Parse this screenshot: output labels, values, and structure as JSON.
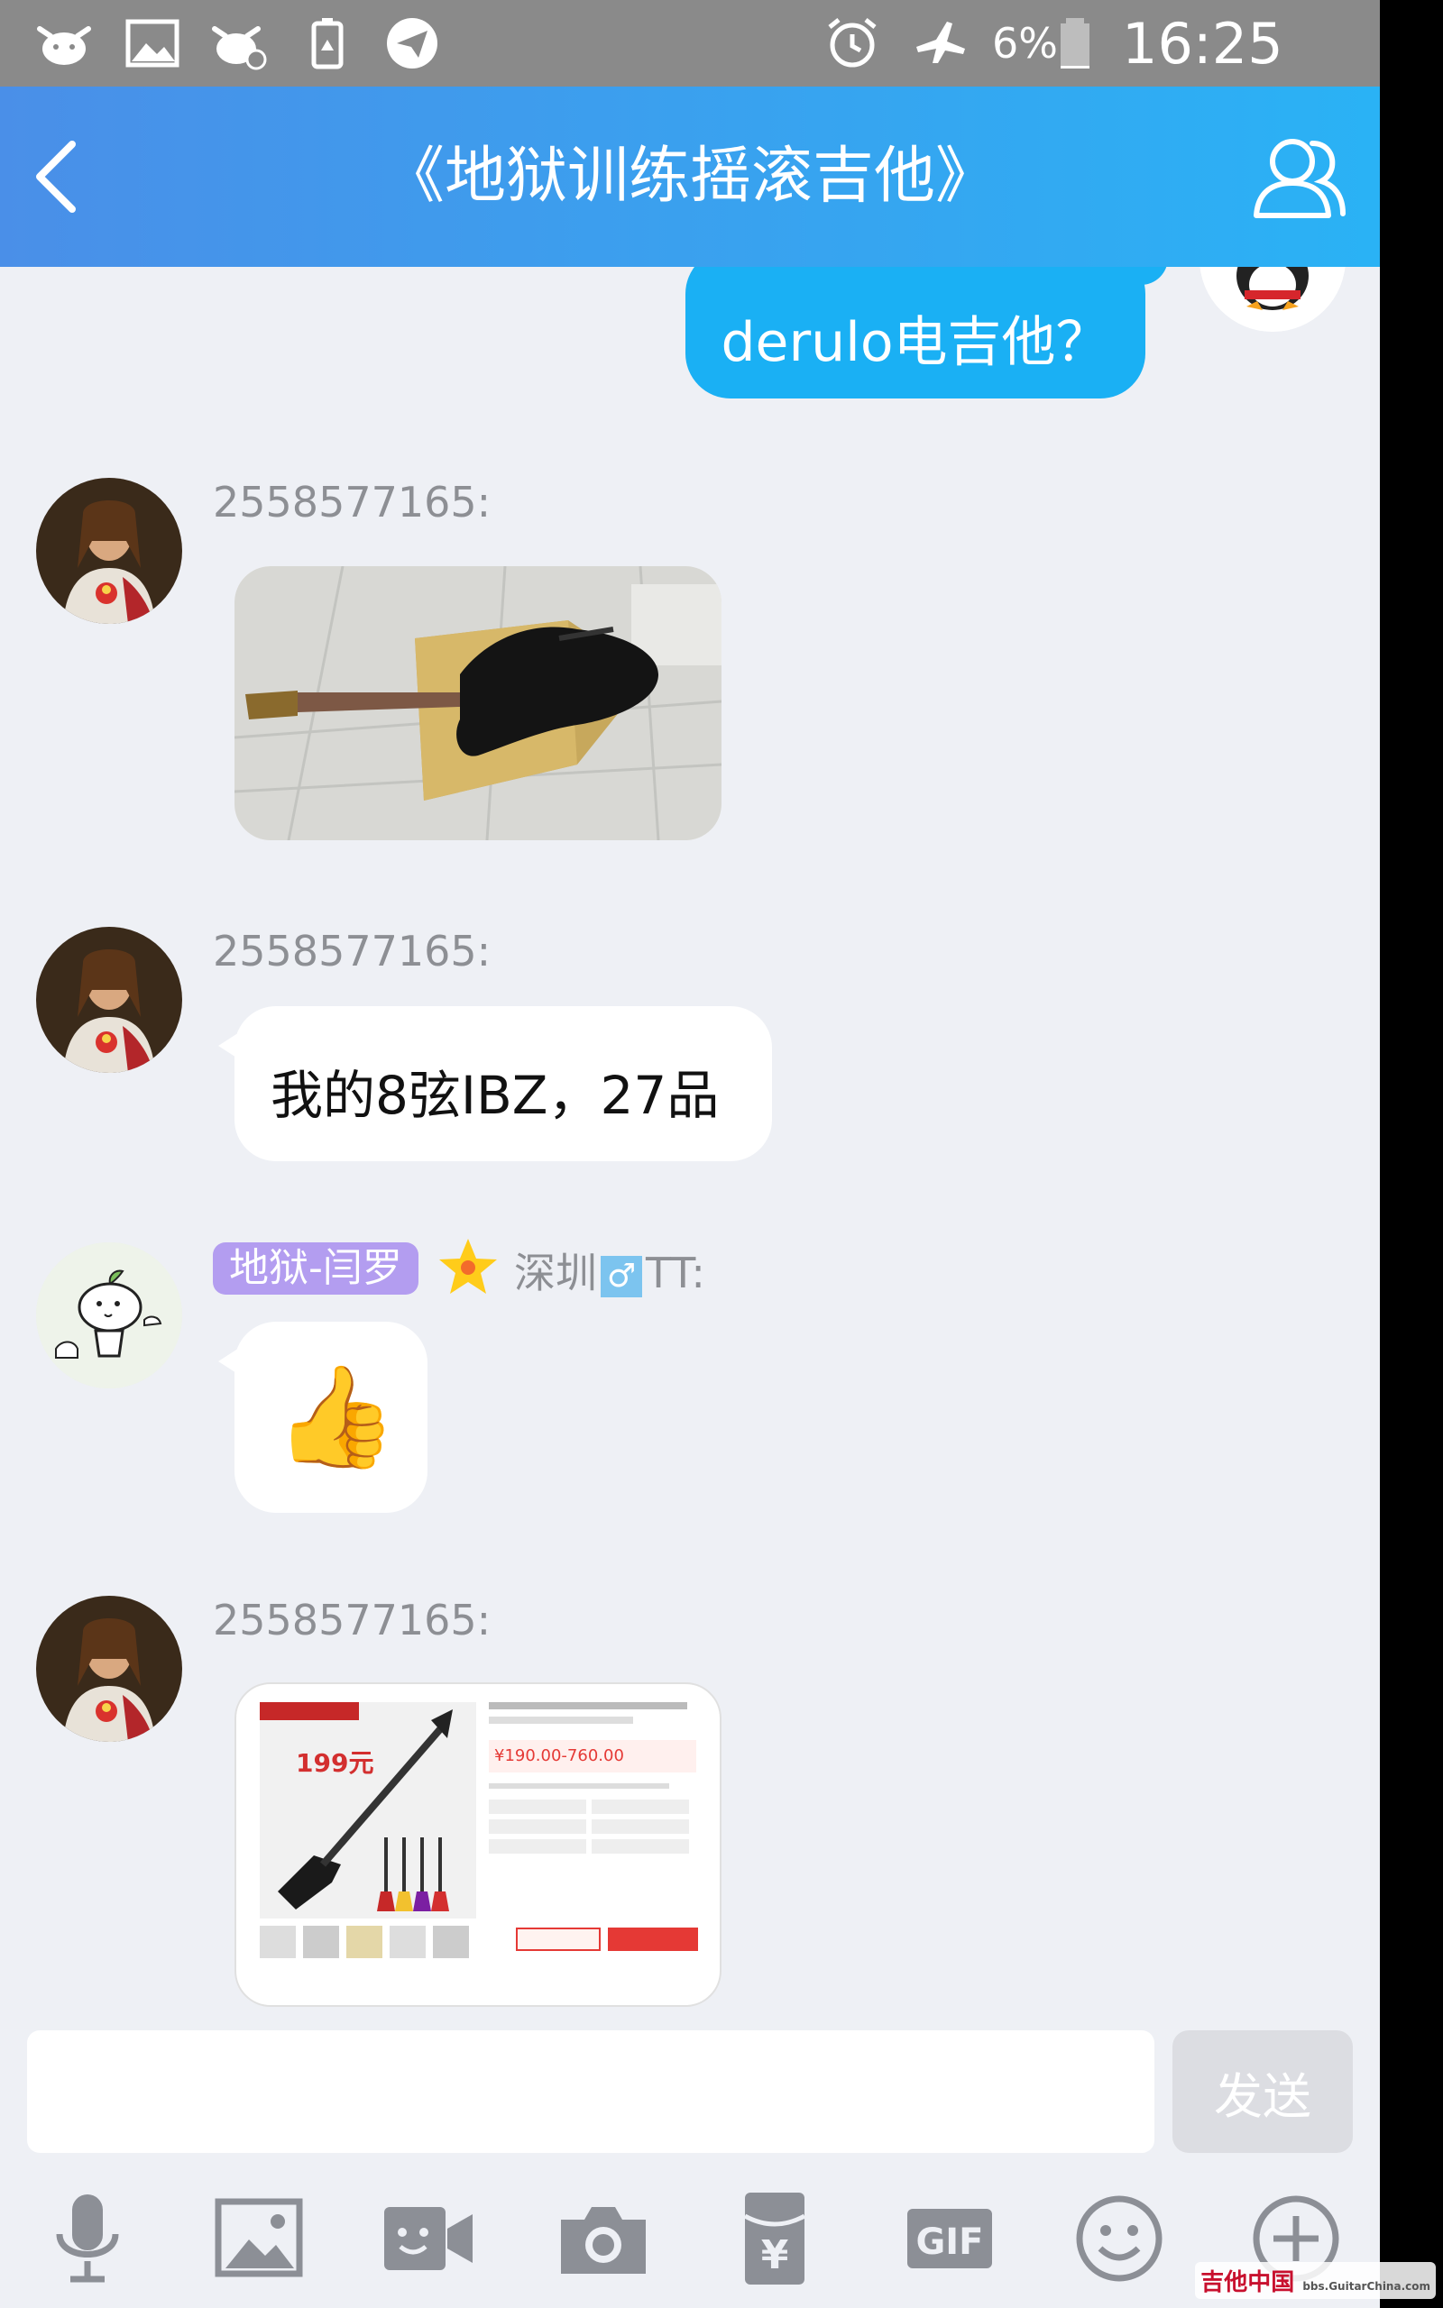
{
  "status_bar": {
    "icons": [
      "cow-icon",
      "gallery-icon",
      "cow-muted-icon",
      "recycle-icon",
      "send-app-icon"
    ],
    "alarm_icon": "alarm-icon",
    "airplane_icon": "airplane-icon",
    "battery_percent": "6%",
    "battery_level": 0.06,
    "time": "16:25"
  },
  "header": {
    "title": "《地狱训练摇滚吉他》",
    "back_icon": "chevron-left-icon",
    "members_icon": "group-members-icon"
  },
  "messages": [
    {
      "direction": "out",
      "type": "text",
      "text": "derulo电吉他？"
    },
    {
      "direction": "in",
      "sender": "2558577165:",
      "type": "image",
      "image": "photo-guitar-on-box"
    },
    {
      "direction": "in",
      "sender": "2558577165:",
      "type": "text",
      "text": "我的8弦IBZ，27品"
    },
    {
      "direction": "in",
      "badge": "地狱-闫罗",
      "sender_meta": "深圳",
      "sender_suffix": "TT:",
      "type": "emoji",
      "emoji": "👍"
    },
    {
      "direction": "in",
      "sender": "2558577165:",
      "type": "image",
      "image": "screenshot-shop-listing",
      "image_texts": {
        "promo_price": "199元",
        "price": "¥190.00-760.00"
      }
    }
  ],
  "input": {
    "value": "",
    "send_label": "发送"
  },
  "toolbar": {
    "items": [
      "microphone-icon",
      "image-icon",
      "video-chat-icon",
      "camera-icon",
      "red-packet-icon",
      "gif-icon",
      "emoji-icon",
      "plus-icon"
    ],
    "gif_label": "GIF",
    "yen_label": "¥"
  },
  "watermark": {
    "text": "吉他中国",
    "subtext": "bbs.GuitarChina.com"
  },
  "colors": {
    "header_start": "#4a8fe8",
    "header_end": "#2ab2f5",
    "out_bubble": "#1ab0f4",
    "background": "#eef0f5",
    "badge": "#b39df0"
  }
}
